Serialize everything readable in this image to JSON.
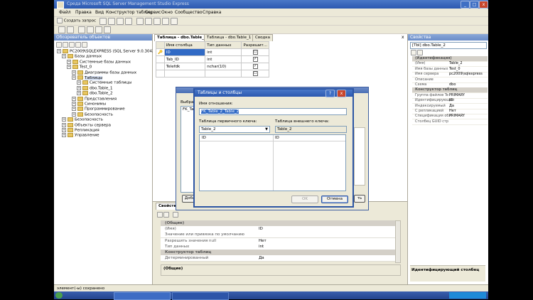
{
  "window": {
    "title": "Среда Microsoft SQL Server Management Studio Express",
    "controls": {
      "minimize": "_",
      "maximize": "□",
      "close": "x"
    }
  },
  "menu": [
    "Файл",
    "Правка",
    "Вид",
    "Конструктор таблиц",
    "Сервис",
    "Окно",
    "Сообщество",
    "Справка"
  ],
  "toolbar": {
    "new_query": "Создать запрос"
  },
  "object_explorer": {
    "title": "Обозреватель объектов",
    "items": [
      {
        "label": "PC2009\\SQLEXPRESS (SQL Server 9.0.3042 - PC2",
        "depth": 0
      },
      {
        "label": "Базы данных",
        "depth": 1
      },
      {
        "label": "Системные базы данных",
        "depth": 2
      },
      {
        "label": "Test_0",
        "depth": 2
      },
      {
        "label": "Диаграммы базы данных",
        "depth": 3
      },
      {
        "label": "Таблицы",
        "depth": 3
      },
      {
        "label": "Системные таблицы",
        "depth": 4
      },
      {
        "label": "dbo.Table_1",
        "depth": 4
      },
      {
        "label": "dbo.Table_2",
        "depth": 4
      },
      {
        "label": "Представления",
        "depth": 3
      },
      {
        "label": "Синонимы",
        "depth": 3
      },
      {
        "label": "Программирование",
        "depth": 3
      },
      {
        "label": "Безопасность",
        "depth": 3
      },
      {
        "label": "Безопасность",
        "depth": 1
      },
      {
        "label": "Объекты сервера",
        "depth": 1
      },
      {
        "label": "Репликация",
        "depth": 1
      },
      {
        "label": "Управление",
        "depth": 1
      }
    ]
  },
  "tabs": [
    "Таблица - dbo.Table_2",
    "Таблица - dbo.Table_1",
    "Сводка"
  ],
  "designer": {
    "headers": [
      "Имя столбца",
      "Тип данных",
      "Разрешит..."
    ],
    "rows": [
      {
        "name": "ID",
        "type": "int",
        "nulls": "☐"
      },
      {
        "name": "Tab_ID",
        "type": "int",
        "nulls": "✓"
      },
      {
        "name": "Telefdk",
        "type": "nchar(10)",
        "nulls": "✓"
      },
      {
        "name": "",
        "type": "",
        "nulls": "☐"
      }
    ]
  },
  "background_dialog": {
    "label": "Выбран",
    "fk_field": "FK_Ta",
    "add_button": "Доба",
    "close_button": "ть"
  },
  "dialog": {
    "title": "Таблицы и столбцы",
    "help": "?",
    "close": "x",
    "relation_name_label": "Имя отношения:",
    "relation_name_value": "FK_Table_2_Table_2",
    "pk_table_label": "Таблица первичного ключа:",
    "pk_table_value": "Table_2",
    "fk_table_label": "Таблица внешнего ключа:",
    "fk_table_value": "Table_2",
    "pk_column": "ID",
    "fk_column": "ID",
    "ok_button": "OK",
    "cancel_button": "Отмена"
  },
  "column_properties": {
    "title": "Свойства с",
    "rows": [
      {
        "key": "(Общие)",
        "value": "",
        "category": true
      },
      {
        "key": "(Имя)",
        "value": "ID",
        "category": false
      },
      {
        "key": "Значение или привязка по умолчанию",
        "value": "",
        "category": false
      },
      {
        "key": "Разрешить значения null",
        "value": "Нет",
        "category": false
      },
      {
        "key": "Тип данных",
        "value": "int",
        "category": false
      },
      {
        "key": "Конструктор таблиц",
        "value": "",
        "category": true
      },
      {
        "key": "Детерминированный",
        "value": "Да",
        "category": false
      }
    ],
    "footer": "(Общие)"
  },
  "properties": {
    "title": "Свойства",
    "object": "[Tbl] dbo.Table_2",
    "rows": [
      {
        "key": "(Идентификация)",
        "value": "",
        "category": true
      },
      {
        "key": "(Имя)",
        "value": "Table_2",
        "category": false
      },
      {
        "key": "Имя базы данных",
        "value": "Test_0",
        "category": false
      },
      {
        "key": "Имя сервера",
        "value": "pc2009\\sqlexpress",
        "category": false
      },
      {
        "key": "Описание",
        "value": "",
        "category": false
      },
      {
        "key": "Схема",
        "value": "dbo",
        "category": false
      },
      {
        "key": "Конструктор таблиц",
        "value": "",
        "category": true
      },
      {
        "key": "Группа файлов Te",
        "value": "PRIMARY",
        "category": false
      },
      {
        "key": "Идентифицирующий",
        "value": "ID",
        "category": false
      },
      {
        "key": "Индексируемый",
        "value": "Да",
        "category": false
      },
      {
        "key": "С репликацией",
        "value": "Нет",
        "category": false
      },
      {
        "key": "Спецификация обл",
        "value": "PRIMARY",
        "category": false
      },
      {
        "key": "Столбец GUID стр",
        "value": "",
        "category": false
      }
    ],
    "footer": "Идентифицирующий столбец"
  },
  "statusbar": {
    "text": "элемент(-ы) сохранено"
  },
  "colors": {
    "titlebar": "#2b58b0",
    "chrome": "#ece9d8",
    "selection": "#316ac5"
  }
}
